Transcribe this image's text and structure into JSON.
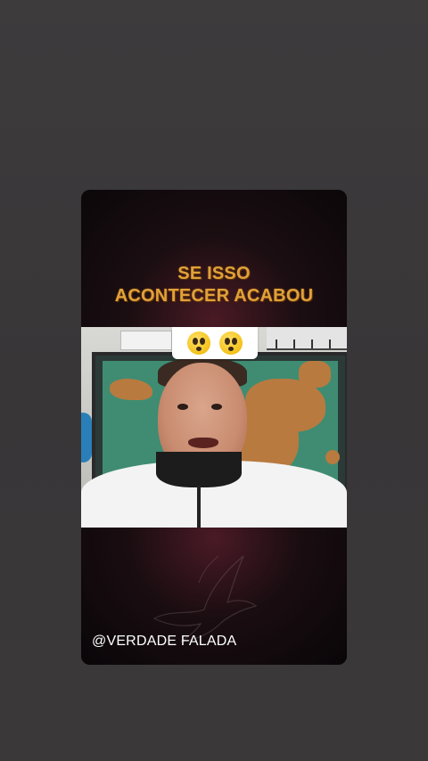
{
  "story": {
    "headline_line1": "SE ISSO",
    "headline_line2": "ACONTECER ACABOU",
    "handle": "@VERDADE FALADA"
  },
  "sticker": {
    "emojis": [
      "astonished-face",
      "astonished-face"
    ]
  },
  "colors": {
    "background": "#3b393a",
    "headline": "#e0a13a",
    "panel_accent": "#4a1a24",
    "handle": "#ffffff"
  }
}
